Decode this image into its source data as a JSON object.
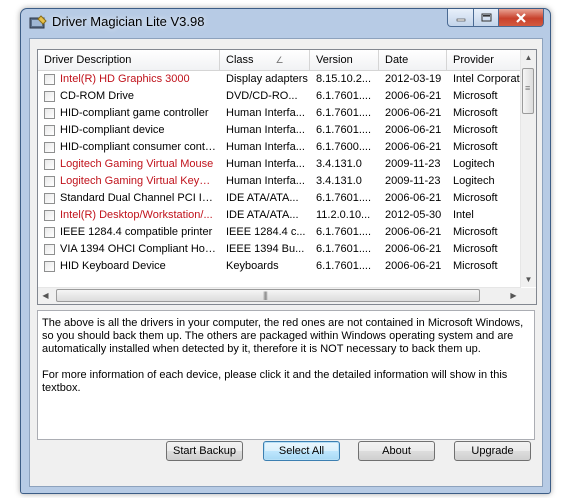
{
  "window": {
    "title": "Driver Magician Lite V3.98",
    "caption_buttons": {
      "minimize": "minimize-icon",
      "maximize": "maximize-icon",
      "close": "close-icon"
    }
  },
  "list": {
    "columns": [
      "Driver Description",
      "Class",
      "Version",
      "Date",
      "Provider"
    ],
    "sorted_column_indicator": "∠",
    "rows": [
      {
        "desc": "Intel(R) HD Graphics 3000",
        "class": "Display adapters",
        "version": "8.15.10.2...",
        "date": "2012-03-19",
        "provider": "Intel Corporat",
        "red": true
      },
      {
        "desc": "CD-ROM Drive",
        "class": "DVD/CD-RO...",
        "version": "6.1.7601....",
        "date": "2006-06-21",
        "provider": "Microsoft",
        "red": false
      },
      {
        "desc": "HID-compliant game controller",
        "class": "Human Interfa...",
        "version": "6.1.7601....",
        "date": "2006-06-21",
        "provider": "Microsoft",
        "red": false
      },
      {
        "desc": "HID-compliant device",
        "class": "Human Interfa...",
        "version": "6.1.7601....",
        "date": "2006-06-21",
        "provider": "Microsoft",
        "red": false
      },
      {
        "desc": "HID-compliant consumer contro...",
        "class": "Human Interfa...",
        "version": "6.1.7600....",
        "date": "2006-06-21",
        "provider": "Microsoft",
        "red": false
      },
      {
        "desc": "Logitech Gaming Virtual Mouse",
        "class": "Human Interfa...",
        "version": "3.4.131.0",
        "date": "2009-11-23",
        "provider": "Logitech",
        "red": true
      },
      {
        "desc": "Logitech Gaming Virtual Keybo...",
        "class": "Human Interfa...",
        "version": "3.4.131.0",
        "date": "2009-11-23",
        "provider": "Logitech",
        "red": true
      },
      {
        "desc": "Standard Dual Channel PCI ID...",
        "class": "IDE ATA/ATA...",
        "version": "6.1.7601....",
        "date": "2006-06-21",
        "provider": "Microsoft",
        "red": false
      },
      {
        "desc": "Intel(R) Desktop/Workstation/...",
        "class": "IDE ATA/ATA...",
        "version": "11.2.0.10...",
        "date": "2012-05-30",
        "provider": "Intel",
        "red": true
      },
      {
        "desc": "IEEE 1284.4 compatible printer",
        "class": "IEEE 1284.4 c...",
        "version": "6.1.7601....",
        "date": "2006-06-21",
        "provider": "Microsoft",
        "red": false
      },
      {
        "desc": "VIA 1394 OHCI Compliant Host ...",
        "class": "IEEE 1394 Bu...",
        "version": "6.1.7601....",
        "date": "2006-06-21",
        "provider": "Microsoft",
        "red": false
      },
      {
        "desc": "HID Keyboard Device",
        "class": "Keyboards",
        "version": "6.1.7601....",
        "date": "2006-06-21",
        "provider": "Microsoft",
        "red": false
      }
    ]
  },
  "info_text": {
    "para1": "The above is all the drivers in your computer, the red ones are not contained in Microsoft Windows, so you should back them up. The others are packaged within Windows operating system and are automatically installed when detected by it, therefore it is NOT necessary to back them up.",
    "para2": "For more information of each device, please click it and the detailed information will show in this textbox."
  },
  "buttons": {
    "start_backup": "Start Backup",
    "select_all": "Select All",
    "about": "About",
    "upgrade": "Upgrade"
  },
  "colors": {
    "non_windows_driver": "#c0121b",
    "default_button": "#a7d9f5",
    "window_frame": "#b7cbe5"
  }
}
